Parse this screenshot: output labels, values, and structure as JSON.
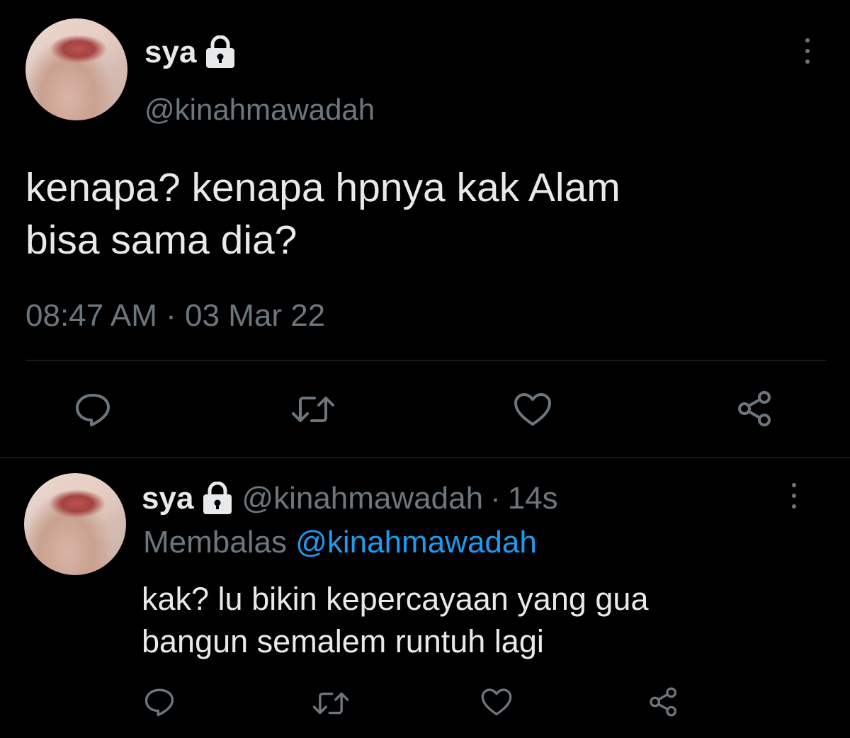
{
  "main_tweet": {
    "display_name": "sya",
    "handle": "@kinahmawadah",
    "text_line1": "kenapa? kenapa hpnya kak Alam",
    "text_line2": "bisa sama dia?",
    "time": "08:47 AM",
    "separator": "·",
    "date": "03 Mar 22",
    "lock_icon": "lock-icon",
    "actions": [
      "reply-icon",
      "retweet-icon",
      "like-icon",
      "share-icon"
    ]
  },
  "reply_tweet": {
    "display_name": "sya",
    "handle": "@kinahmawadah",
    "separator": "·",
    "age": "14s",
    "replying_label": "Membalas",
    "replying_to": "@kinahmawadah",
    "text_line1": "kak? lu bikin kepercayaan yang gua",
    "text_line2": "bangun semalem runtuh lagi",
    "actions": [
      "reply-icon",
      "retweet-icon",
      "like-icon",
      "share-icon"
    ]
  },
  "colors": {
    "background": "#000000",
    "primary_text": "#e7e9ea",
    "secondary_text": "#6e767d",
    "link": "#1d9bf0",
    "divider": "#2f3336"
  }
}
